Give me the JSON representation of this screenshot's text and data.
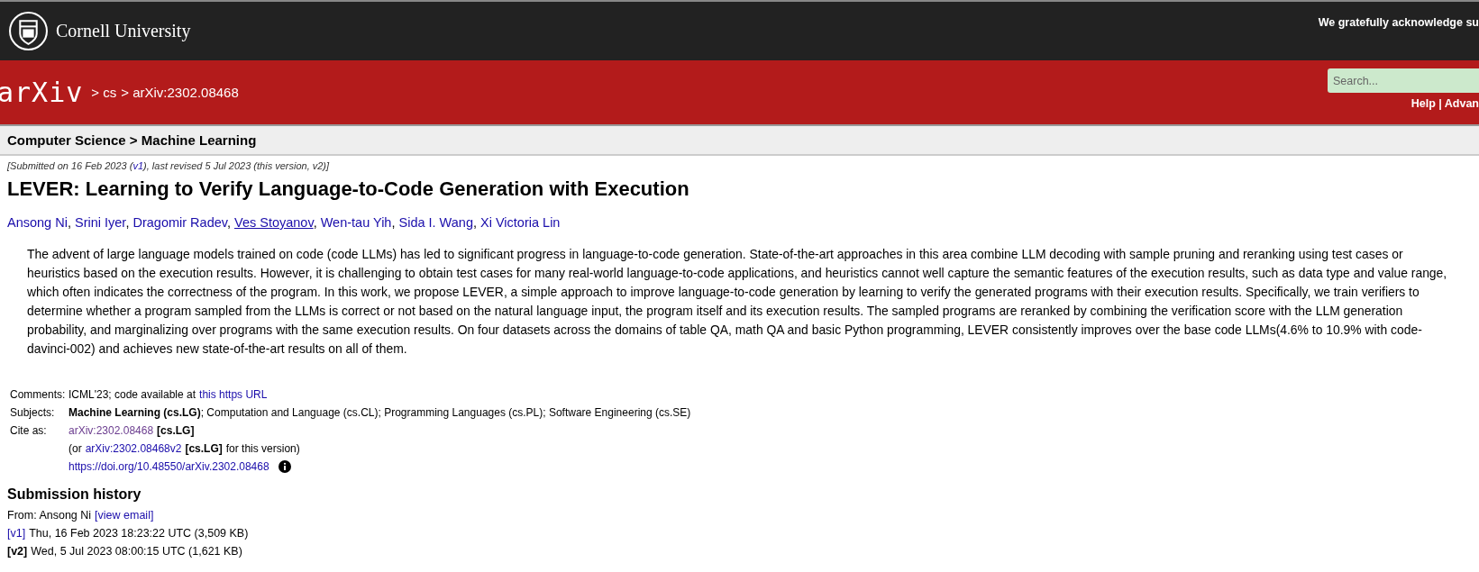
{
  "header": {
    "university": "Cornell University",
    "acknowledgement": "We gratefully acknowledge su"
  },
  "banner": {
    "logo": "arXiv",
    "breadcrumb": [
      {
        "text": "> cs"
      },
      {
        "text": "> arXiv:2302.08468"
      }
    ],
    "search": {
      "placeholder": "Search..."
    },
    "links": "Help | Advan"
  },
  "category": "Computer Science > Machine Learning",
  "dateline": [
    {
      "kind": "text",
      "text": "[Submitted on 16 Feb 2023 ("
    },
    {
      "kind": "link",
      "text": "v1",
      "visited": false
    },
    {
      "kind": "text",
      "text": "), last revised 5 Jul 2023 (this version, v2)]"
    }
  ],
  "title": "LEVER: Learning to Verify Language-to-Code Generation with Execution",
  "author_separator": ",",
  "authors": [
    {
      "name": "Ansong Ni",
      "hovered": false
    },
    {
      "name": "Srini Iyer",
      "hovered": false
    },
    {
      "name": "Dragomir Radev",
      "hovered": false
    },
    {
      "name": "Ves Stoyanov",
      "hovered": true
    },
    {
      "name": "Wen-tau Yih",
      "hovered": false
    },
    {
      "name": "Sida I. Wang",
      "hovered": false
    },
    {
      "name": "Xi Victoria Lin",
      "hovered": false
    }
  ],
  "abstract": "The advent of large language models trained on code (code LLMs) has led to significant progress in language-to-code generation. State-of-the-art approaches in this area combine LLM decoding with sample pruning and reranking using test cases or heuristics based on the execution results. However, it is challenging to obtain test cases for many real-world language-to-code applications, and heuristics cannot well capture the semantic features of the execution results, such as data type and value range, which often indicates the correctness of the program. In this work, we propose LEVER, a simple approach to improve language-to-code generation by learning to verify the generated programs with their execution results. Specifically, we train verifiers to determine whether a program sampled from the LLMs is correct or not based on the natural language input, the program itself and its execution results. The sampled programs are reranked by combining the verification score with the LLM generation probability, and marginalizing over programs with the same execution results. On four datasets across the domains of table QA, math QA and basic Python programming, LEVER consistently improves over the base code LLMs(4.6% to 10.9% with code-davinci-002) and achieves new state-of-the-art results on all of them.",
  "metadata": [
    {
      "label": "Comments:",
      "lines": [
        [
          {
            "kind": "text",
            "text": "ICML'23; code available at "
          },
          {
            "kind": "link",
            "text": "this https URL",
            "visited": false
          }
        ]
      ]
    },
    {
      "label": "Subjects:",
      "lines": [
        [
          {
            "kind": "text",
            "text": "**Machine Learning (cs.LG)**; Computation and Language (cs.CL); Programming Languages (cs.PL); Software Engineering (cs.SE)"
          }
        ]
      ]
    },
    {
      "label": "Cite as:",
      "lines": [
        [
          {
            "kind": "link",
            "text": "arXiv:2302.08468",
            "visited": true
          },
          {
            "kind": "bold",
            "text": "[cs.LG]"
          }
        ],
        [
          {
            "kind": "text",
            "text": "(or"
          },
          {
            "kind": "link",
            "text": "arXiv:2302.08468v2",
            "visited": false
          },
          {
            "kind": "bold",
            "text": "[cs.LG]"
          },
          {
            "kind": "text",
            "text": "for this version)"
          }
        ],
        [
          {
            "kind": "link",
            "text": "https://doi.org/10.48550/arXiv.2302.08468",
            "visited": false
          },
          {
            "kind": "info"
          }
        ]
      ]
    }
  ],
  "history": {
    "heading": "Submission history",
    "from": [
      {
        "kind": "text",
        "text": "From: Ansong Ni"
      },
      {
        "kind": "link",
        "text": "[view email]",
        "visited": false
      }
    ],
    "versions": [
      {
        "version": "[v1]",
        "current": false,
        "text": "Thu, 16 Feb 2023 18:23:22 UTC (3,509 KB)"
      },
      {
        "version": "[v2]",
        "current": true,
        "text": "Wed, 5 Jul 2023 08:00:15 UTC (1,621 KB)"
      }
    ]
  }
}
